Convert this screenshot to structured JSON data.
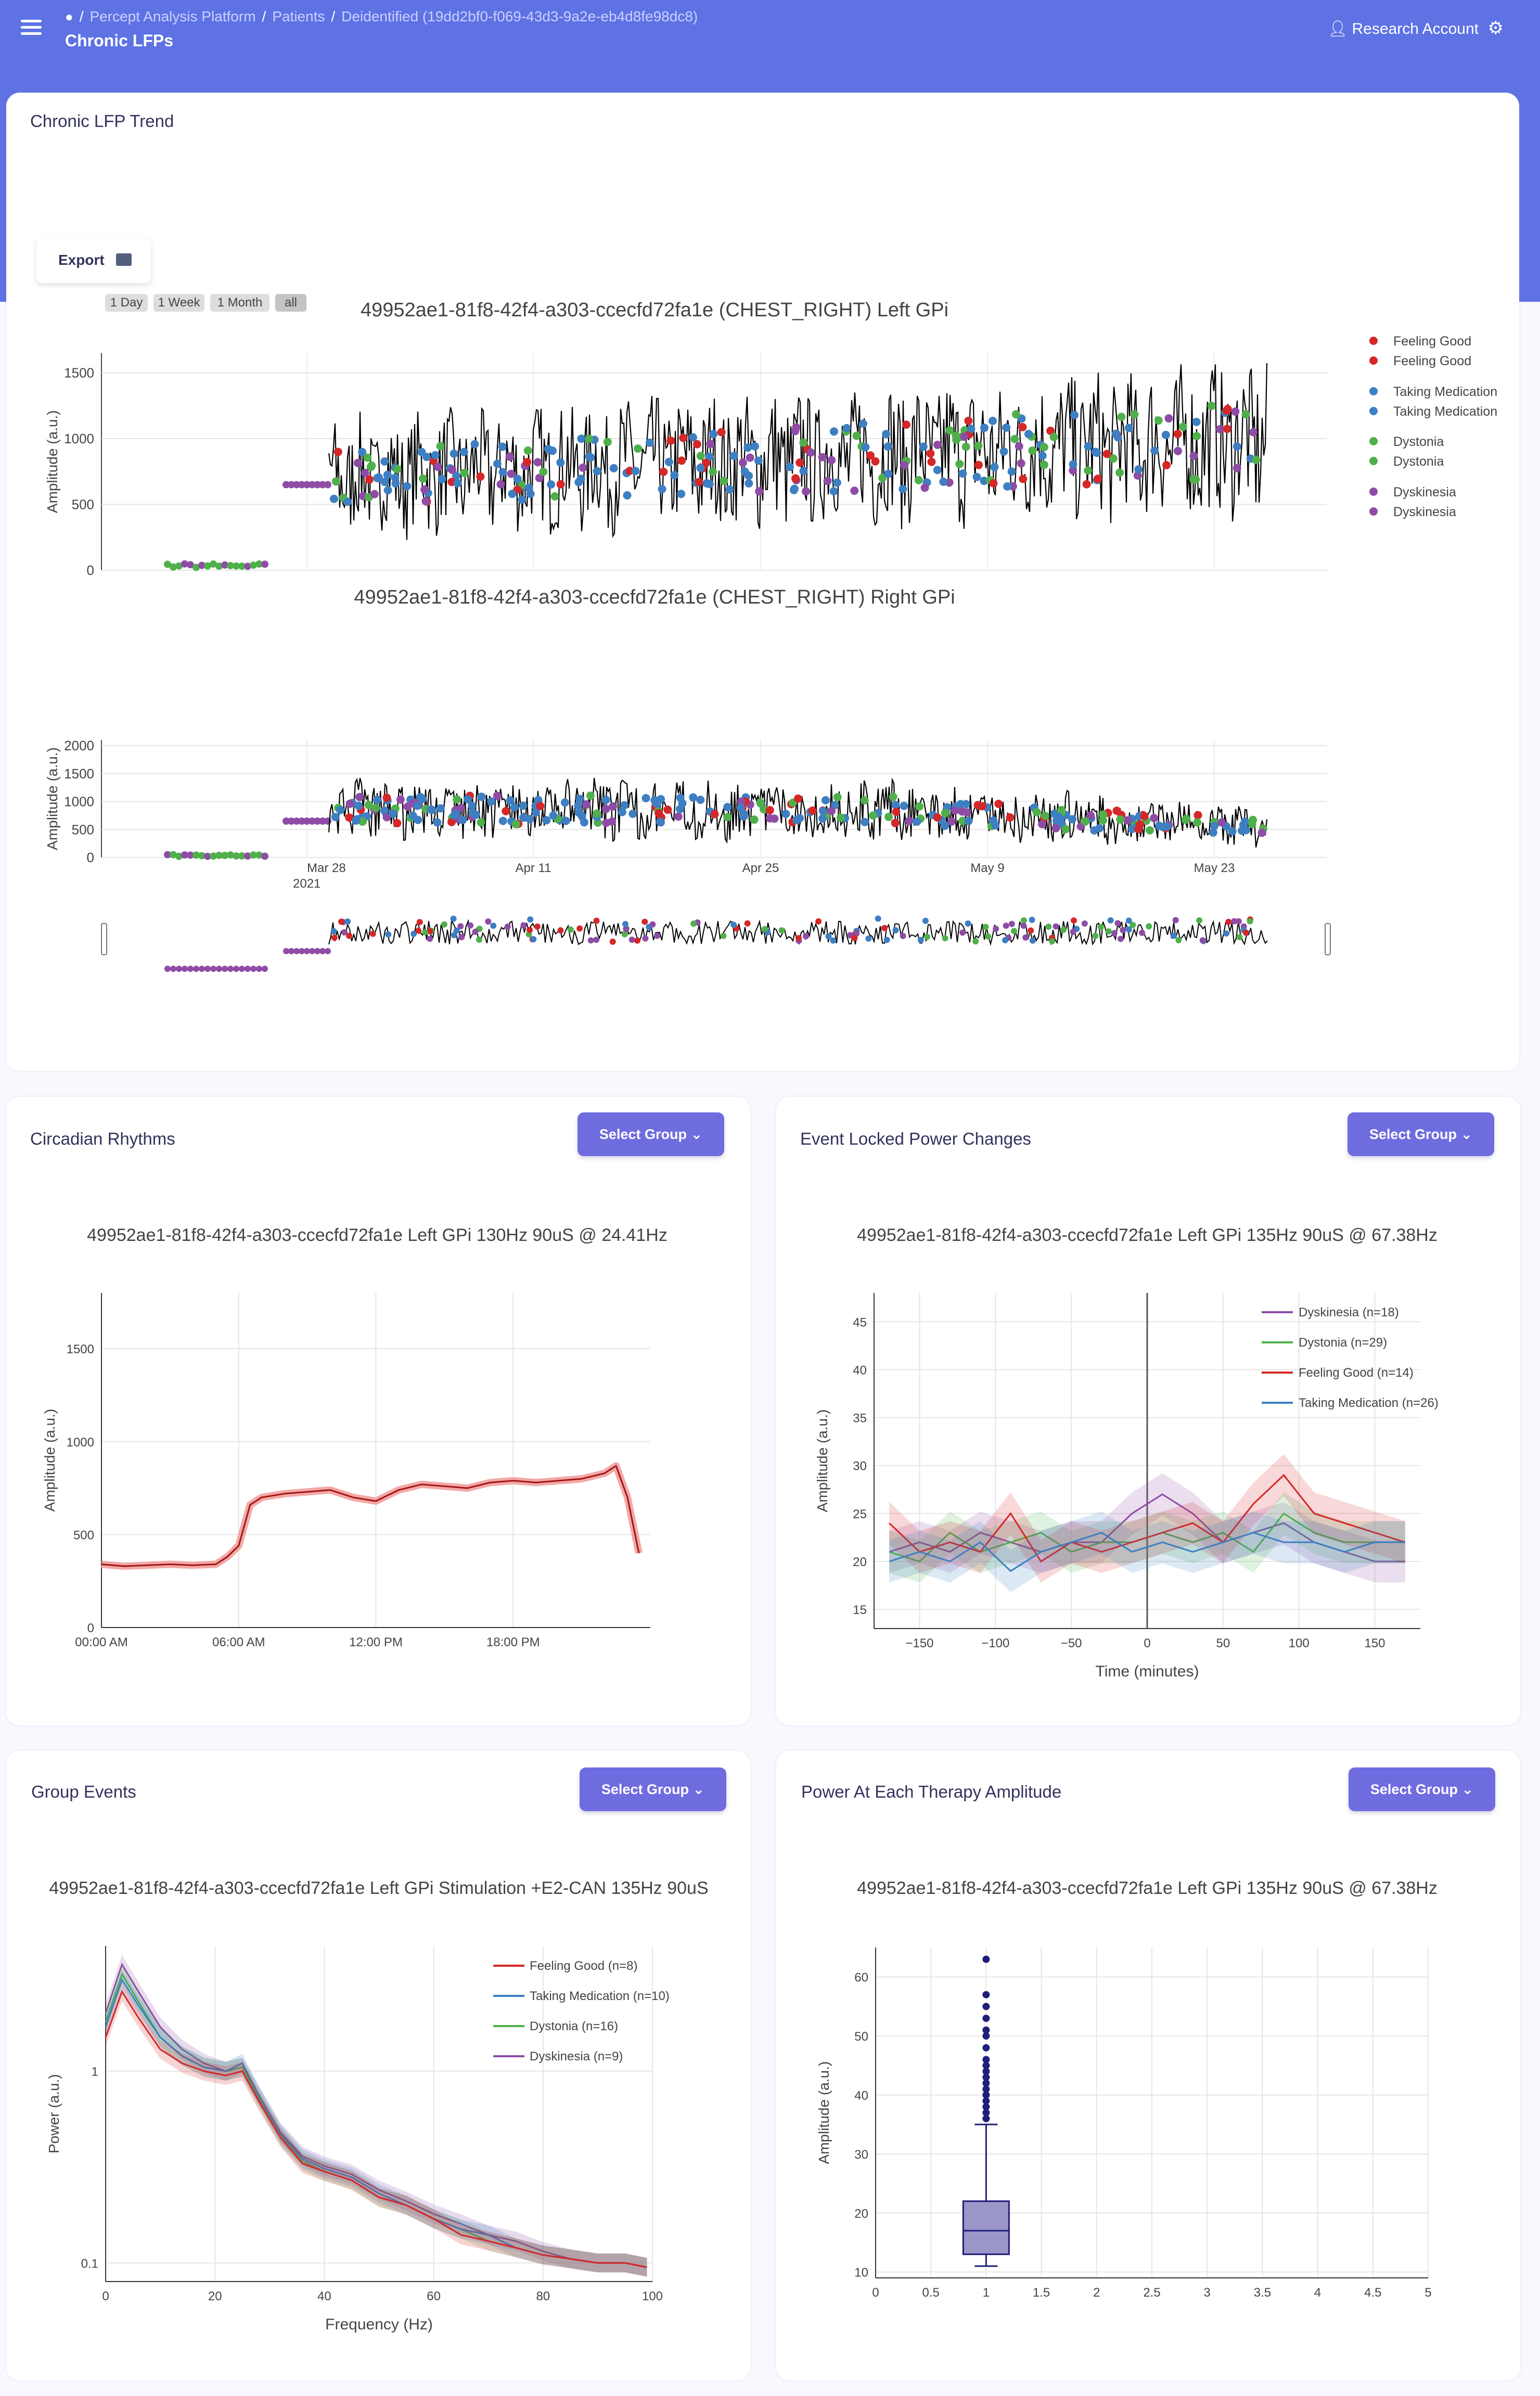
{
  "header": {
    "breadcrumb": [
      "Percept Analysis Platform",
      "Patients",
      "Deidentified (19dd2bf0-f069-43d3-9a2e-eb4d8fe98dc8)"
    ],
    "page_title": "Chronic LFPs",
    "account_label": "Research Account"
  },
  "trend": {
    "card_title": "Chronic LFP Trend",
    "export_label": "Export",
    "range_buttons": [
      "1 Day",
      "1 Week",
      "1 Month",
      "all"
    ],
    "top_title": "49952ae1-81f8-42f4-a303-ccecfd72fa1e (CHEST_RIGHT) Left GPi",
    "bottom_title": "49952ae1-81f8-42f4-a303-ccecfd72fa1e (CHEST_RIGHT) Right GPi",
    "ylabel": "Amplitude (a.u.)",
    "top_yticks": [
      "0",
      "500",
      "1000",
      "1500"
    ],
    "bottom_yticks": [
      "0",
      "500",
      "1000",
      "1500",
      "2000"
    ],
    "xticks": [
      "Mar 28",
      "Apr 11",
      "Apr 25",
      "May 9",
      "May 23"
    ],
    "xtick_year": "2021",
    "legend": [
      {
        "label": "Feeling Good",
        "color": "#d62728"
      },
      {
        "label": "Feeling Good",
        "color": "#d62728"
      },
      {
        "label": "Taking Medication",
        "color": "#3d7fc2"
      },
      {
        "label": "Taking Medication",
        "color": "#3d7fc2"
      },
      {
        "label": "Dystonia",
        "color": "#4fb04b"
      },
      {
        "label": "Dystonia",
        "color": "#4fb04b"
      },
      {
        "label": "Dyskinesia",
        "color": "#8e4ca6"
      },
      {
        "label": "Dyskinesia",
        "color": "#8e4ca6"
      }
    ]
  },
  "circadian": {
    "card_title": "Circadian Rhythms",
    "select_label": "Select Group",
    "plot_title": "49952ae1-81f8-42f4-a303-ccecfd72fa1e Left GPi 130Hz 90uS @ 24.41Hz",
    "ylabel": "Amplitude (a.u.)",
    "yticks": [
      "0",
      "500",
      "1000",
      "1500"
    ],
    "xticks": [
      "00:00 AM",
      "06:00 AM",
      "12:00 PM",
      "18:00 PM"
    ]
  },
  "event_locked": {
    "card_title": "Event Locked Power Changes",
    "select_label": "Select Group",
    "plot_title": "49952ae1-81f8-42f4-a303-ccecfd72fa1e Left GPi 135Hz 90uS @ 67.38Hz",
    "ylabel": "Amplitude (a.u.)",
    "xlabel": "Time (minutes)",
    "yticks": [
      "15",
      "20",
      "25",
      "30",
      "35",
      "40",
      "45"
    ],
    "xticks": [
      "−150",
      "−100",
      "−50",
      "0",
      "50",
      "100",
      "150"
    ],
    "legend": [
      {
        "label": "Dyskinesia (n=18)",
        "color": "#8e4ca6"
      },
      {
        "label": "Dystonia (n=29)",
        "color": "#4fb04b"
      },
      {
        "label": "Feeling Good (n=14)",
        "color": "#d62728"
      },
      {
        "label": "Taking Medication (n=26)",
        "color": "#3d7fc2"
      }
    ]
  },
  "group_events": {
    "card_title": "Group Events",
    "select_label": "Select Group",
    "plot_title": "49952ae1-81f8-42f4-a303-ccecfd72fa1e Left GPi Stimulation +E2-CAN 135Hz 90uS",
    "ylabel": "Power (a.u.)",
    "xlabel": "Frequency (Hz)",
    "yticks": [
      "0.1",
      "1"
    ],
    "xticks": [
      "0",
      "20",
      "40",
      "60",
      "80",
      "100"
    ],
    "legend": [
      {
        "label": "Feeling Good (n=8)",
        "color": "#d62728"
      },
      {
        "label": "Taking Medication (n=10)",
        "color": "#3d7fc2"
      },
      {
        "label": "Dystonia (n=16)",
        "color": "#4fb04b"
      },
      {
        "label": "Dyskinesia (n=9)",
        "color": "#8e4ca6"
      }
    ]
  },
  "therapy": {
    "card_title": "Power At Each Therapy Amplitude",
    "select_label": "Select Group",
    "plot_title": "49952ae1-81f8-42f4-a303-ccecfd72fa1e Left GPi 135Hz 90uS @ 67.38Hz",
    "ylabel": "Amplitude (a.u.)",
    "yticks": [
      "10",
      "20",
      "30",
      "40",
      "50",
      "60"
    ],
    "xticks": [
      "0",
      "0.5",
      "1",
      "1.5",
      "2",
      "2.5",
      "3",
      "3.5",
      "4",
      "4.5",
      "5"
    ]
  },
  "chart_data": [
    {
      "type": "line",
      "title": "49952ae1-81f8-42f4-a303-ccecfd72fa1e Left GPi 130Hz 90uS @ 24.41Hz",
      "xlabel": "",
      "ylabel": "Amplitude (a.u.)",
      "x_unit": "hour of day",
      "ylim": [
        0,
        1800
      ],
      "xlim": [
        0,
        24
      ],
      "x": [
        0,
        1,
        2,
        3,
        4,
        5,
        5.5,
        6,
        6.5,
        7,
        8,
        9,
        10,
        11,
        12,
        13,
        14,
        15,
        16,
        17,
        18,
        19,
        20,
        21,
        22,
        22.5,
        23,
        23.5
      ],
      "series": [
        {
          "values": [
            340,
            330,
            335,
            340,
            335,
            340,
            380,
            440,
            660,
            700,
            720,
            730,
            740,
            700,
            680,
            740,
            770,
            760,
            750,
            780,
            790,
            780,
            790,
            800,
            830,
            870,
            700,
            400
          ]
        }
      ]
    },
    {
      "type": "line",
      "title": "49952ae1-81f8-42f4-a303-ccecfd72fa1e Left GPi 135Hz 90uS @ 67.38Hz",
      "xlabel": "Time (minutes)",
      "ylabel": "Amplitude (a.u.)",
      "x": [
        -170,
        -150,
        -130,
        -110,
        -90,
        -70,
        -50,
        -30,
        -10,
        10,
        30,
        50,
        70,
        90,
        110,
        130,
        150,
        170
      ],
      "series": [
        {
          "name": "Dyskinesia (n=18)",
          "values": [
            21,
            22,
            21,
            23,
            22,
            21,
            22,
            22,
            25,
            27,
            25,
            22,
            23,
            24,
            22,
            21,
            20,
            20
          ]
        },
        {
          "name": "Dystonia (n=29)",
          "values": [
            21,
            20,
            23,
            21,
            22,
            23,
            21,
            22,
            22,
            23,
            22,
            23,
            21,
            25,
            23,
            22,
            22,
            22
          ]
        },
        {
          "name": "Feeling Good (n=14)",
          "values": [
            24,
            21,
            22,
            21,
            25,
            20,
            22,
            21,
            22,
            23,
            24,
            22,
            26,
            29,
            25,
            24,
            23,
            22
          ]
        },
        {
          "name": "Taking Medication (n=26)",
          "values": [
            20,
            21,
            20,
            22,
            19,
            21,
            22,
            23,
            21,
            22,
            21,
            22,
            23,
            22,
            22,
            21,
            22,
            22
          ]
        }
      ],
      "ylim": [
        13,
        48
      ],
      "xlim": [
        -180,
        180
      ]
    },
    {
      "type": "line",
      "title": "49952ae1-81f8-42f4-a303-ccecfd72fa1e Left GPi Stimulation +E2-CAN 135Hz 90uS",
      "xlabel": "Frequency (Hz)",
      "ylabel": "Power (a.u.)",
      "log_y": true,
      "x": [
        0,
        3,
        6,
        10,
        14,
        18,
        22,
        25,
        28,
        32,
        36,
        40,
        45,
        50,
        55,
        60,
        65,
        70,
        75,
        80,
        85,
        90,
        95,
        99
      ],
      "series": [
        {
          "name": "Feeling Good (n=8)",
          "values": [
            1.5,
            2.6,
            1.9,
            1.3,
            1.1,
            1.0,
            0.95,
            1.0,
            0.7,
            0.45,
            0.33,
            0.3,
            0.27,
            0.22,
            0.2,
            0.17,
            0.14,
            0.13,
            0.12,
            0.11,
            0.105,
            0.1,
            0.1,
            0.095
          ]
        },
        {
          "name": "Taking Medication (n=10)",
          "values": [
            1.7,
            3.0,
            2.2,
            1.5,
            1.2,
            1.05,
            1.0,
            1.1,
            0.75,
            0.47,
            0.35,
            0.31,
            0.28,
            0.23,
            0.2,
            0.17,
            0.15,
            0.14,
            0.12,
            0.11,
            0.105,
            0.1,
            0.1,
            0.095
          ]
        },
        {
          "name": "Dystonia (n=16)",
          "values": [
            1.8,
            3.2,
            2.3,
            1.5,
            1.2,
            1.05,
            1.0,
            1.05,
            0.72,
            0.46,
            0.34,
            0.3,
            0.27,
            0.22,
            0.2,
            0.17,
            0.15,
            0.13,
            0.12,
            0.11,
            0.105,
            0.1,
            0.1,
            0.095
          ]
        },
        {
          "name": "Dyskinesia (n=9)",
          "values": [
            2.0,
            3.6,
            2.6,
            1.7,
            1.3,
            1.1,
            1.0,
            1.05,
            0.75,
            0.48,
            0.36,
            0.32,
            0.29,
            0.24,
            0.21,
            0.18,
            0.16,
            0.14,
            0.13,
            0.115,
            0.105,
            0.1,
            0.1,
            0.095
          ]
        }
      ],
      "xlim": [
        0,
        100
      ],
      "ylim": [
        0.08,
        4.5
      ]
    },
    {
      "type": "box",
      "title": "49952ae1-81f8-42f4-a303-ccecfd72fa1e Left GPi 135Hz 90uS @ 67.38Hz",
      "ylabel": "Amplitude (a.u.)",
      "x": 1,
      "q1": 13,
      "median": 17,
      "q3": 22,
      "whisker_low": 11,
      "whisker_high": 35,
      "outliers": [
        36,
        37,
        38,
        39,
        40,
        41,
        42,
        43,
        44,
        45,
        46,
        48,
        50,
        51,
        53,
        55,
        57,
        63
      ],
      "xlim": [
        0,
        5
      ],
      "ylim": [
        9,
        65
      ]
    }
  ]
}
